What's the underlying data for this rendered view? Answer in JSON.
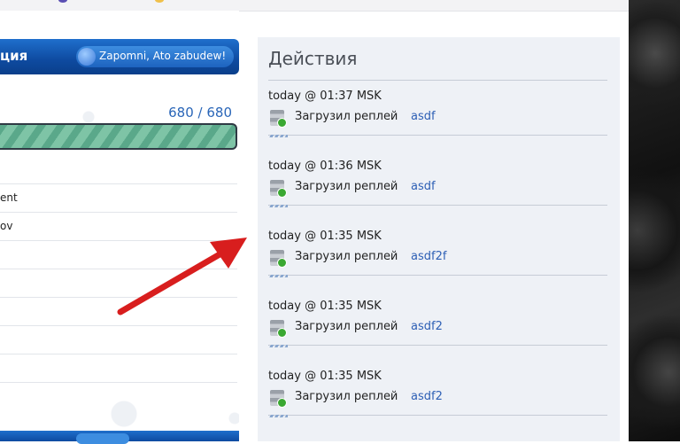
{
  "left_panel": {
    "header_title": "ция",
    "header_pill": "Zapomni, Ato zabudew!",
    "hp_value": "680 / 680",
    "rows": [
      "ent",
      "ov",
      "",
      "",
      "",
      "",
      "",
      "",
      ""
    ]
  },
  "actions": {
    "heading": "Действия",
    "entries": [
      {
        "time": "today @ 01:37 MSK",
        "label": "Загрузил реплей",
        "link": "asdf"
      },
      {
        "time": "today @ 01:36 MSK",
        "label": "Загрузил реплей",
        "link": "asdf"
      },
      {
        "time": "today @ 01:35 MSK",
        "label": "Загрузил реплей",
        "link": "asdf2f"
      },
      {
        "time": "today @ 01:35 MSK",
        "label": "Загрузил реплей",
        "link": "asdf2"
      },
      {
        "time": "today @ 01:35 MSK",
        "label": "Загрузил реплей",
        "link": "asdf2"
      }
    ]
  },
  "colors": {
    "accent_blue": "#0e4aa0",
    "link": "#2d5fb5",
    "annotation_arrow": "#d81e1e",
    "hp_bar": "#7ec4a6"
  },
  "icons": {
    "replay_upload": "server-add-icon",
    "header_ball": "globe-icon"
  }
}
